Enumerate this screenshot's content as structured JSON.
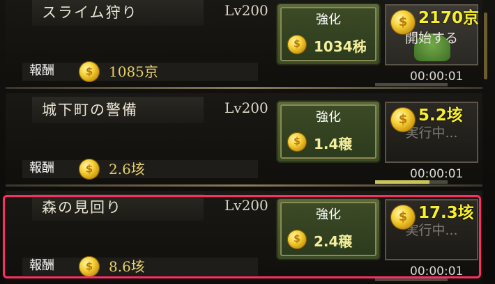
{
  "quests": [
    {
      "name": "スライム狩り",
      "level": "Lv200",
      "reward_label": "報酬",
      "reward_value": "1085京",
      "upgrade_label": "強化",
      "upgrade_cost": "1034秭",
      "status_text": "開始する",
      "earnings": "2170京",
      "timer": "00:00:01"
    },
    {
      "name": "城下町の警備",
      "level": "Lv200",
      "reward_label": "報酬",
      "reward_value": "2.6垓",
      "upgrade_label": "強化",
      "upgrade_cost": "1.4穣",
      "status_text": "実行中...",
      "earnings": "5.2垓",
      "timer": "00:00:01"
    },
    {
      "name": "森の見回り",
      "level": "Lv200",
      "reward_label": "報酬",
      "reward_value": "8.6垓",
      "upgrade_label": "強化",
      "upgrade_cost": "2.4穣",
      "status_text": "実行中...",
      "earnings": "17.3垓",
      "timer": "00:00:01"
    }
  ],
  "progress": [
    0.0,
    0.75,
    0.0
  ],
  "colors": {
    "highlight": "#ff2d63",
    "gold_text": "#f7ef2a",
    "button_green": "#3b4b25"
  },
  "icons": [
    "coin-icon",
    "slime-icon"
  ]
}
